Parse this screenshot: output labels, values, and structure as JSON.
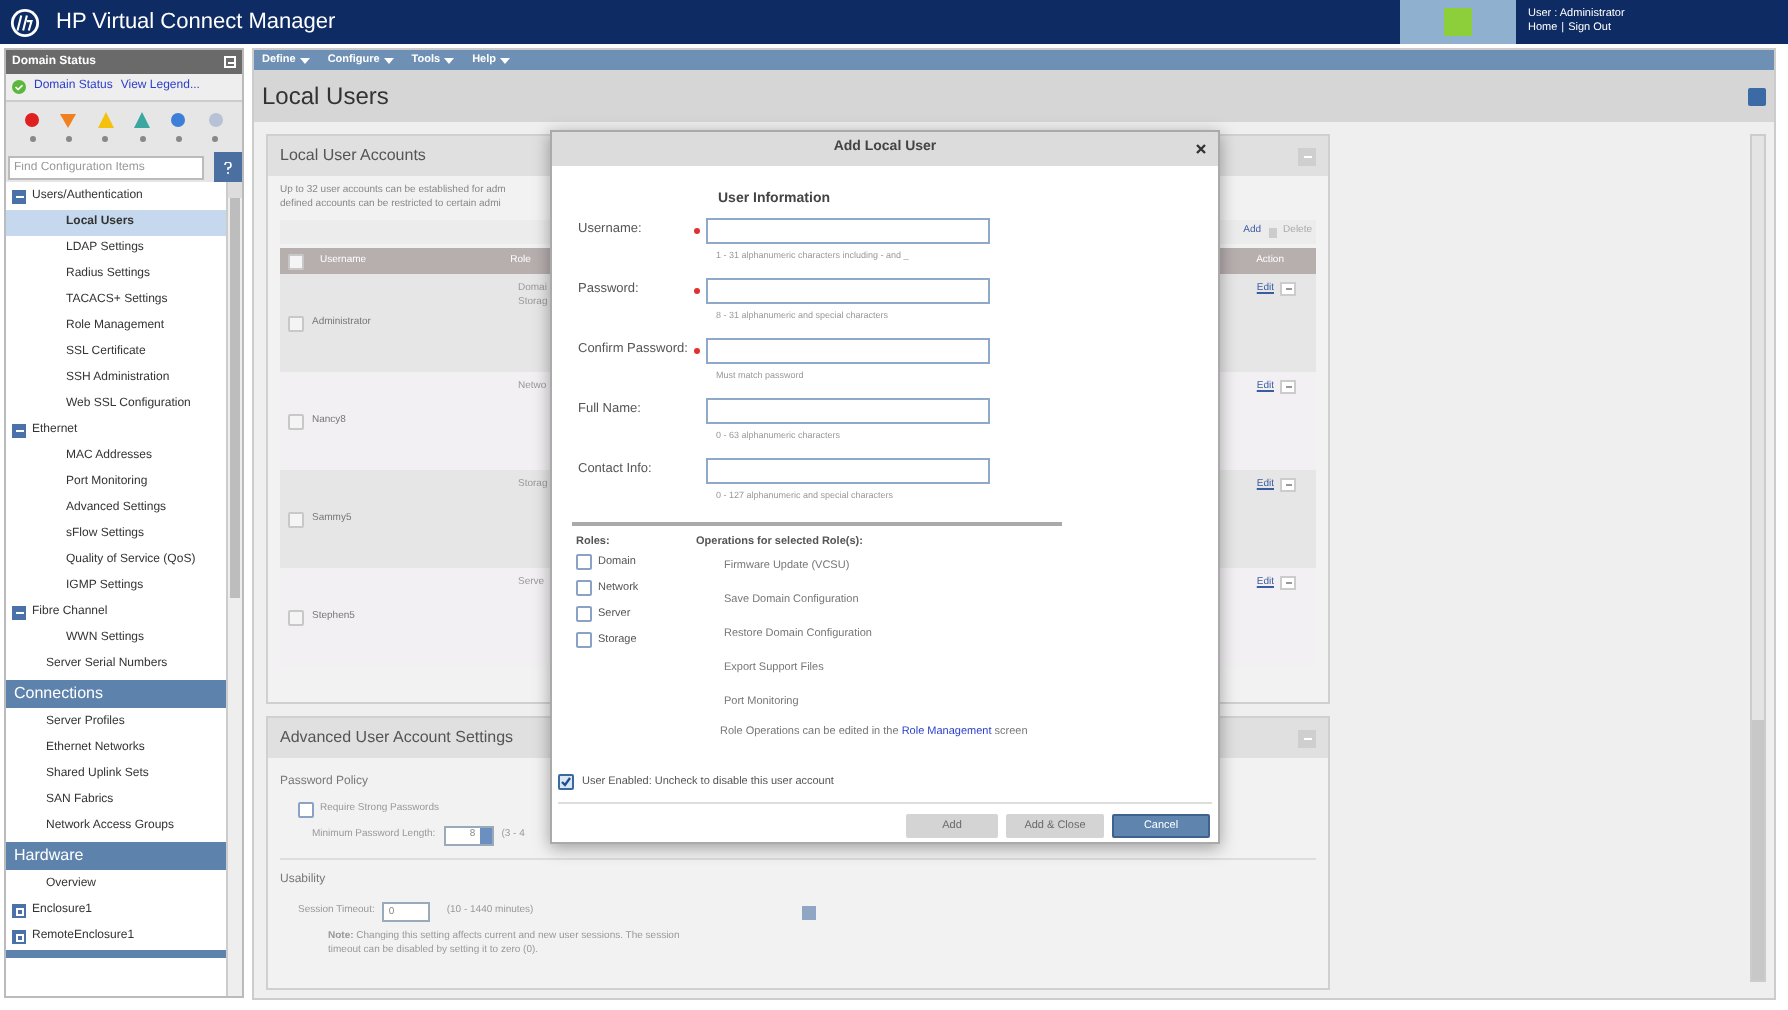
{
  "header": {
    "title": "HP Virtual Connect Manager",
    "user_label": "User : Administrator",
    "links": [
      "Home",
      "Sign Out"
    ],
    "link_separator": "|"
  },
  "sidebar": {
    "status_title": "Domain Status",
    "status_links": [
      "Domain Status",
      "View Legend..."
    ],
    "search": {
      "placeholder": "Find Configuration Items"
    },
    "tree": [
      {
        "kind": "group",
        "label": "Users/Authentication",
        "expanded": true,
        "children": [
          {
            "kind": "item",
            "label": "Local Users",
            "selected": true
          },
          {
            "kind": "item",
            "label": "LDAP Settings",
            "selected": false
          },
          {
            "kind": "item",
            "label": "Radius Settings",
            "selected": false
          },
          {
            "kind": "item",
            "label": "TACACS+ Settings",
            "selected": false
          },
          {
            "kind": "item",
            "label": "Role Management",
            "selected": false
          },
          {
            "kind": "item",
            "label": "SSL Certificate",
            "selected": false
          },
          {
            "kind": "item",
            "label": "SSH Administration",
            "selected": false
          },
          {
            "kind": "item",
            "label": "Web SSL Configuration",
            "selected": false
          }
        ]
      },
      {
        "kind": "group",
        "label": "Ethernet",
        "expanded": true,
        "children": [
          {
            "kind": "item",
            "label": "MAC Addresses",
            "selected": false
          },
          {
            "kind": "item",
            "label": "Port Monitoring",
            "selected": false
          },
          {
            "kind": "item",
            "label": "Advanced Settings",
            "selected": false
          },
          {
            "kind": "item",
            "label": "sFlow Settings",
            "selected": false
          },
          {
            "kind": "item",
            "label": "Quality of Service (QoS)",
            "selected": false
          },
          {
            "kind": "item",
            "label": "IGMP Settings",
            "selected": false
          }
        ]
      },
      {
        "kind": "group",
        "label": "Fibre Channel",
        "expanded": true,
        "children": [
          {
            "kind": "item",
            "label": "WWN Settings",
            "selected": false
          }
        ]
      },
      {
        "kind": "leaf",
        "label": "Server Serial Numbers",
        "selected": false
      },
      {
        "kind": "section",
        "label": "Connections"
      },
      {
        "kind": "leaf",
        "label": "Server Profiles",
        "selected": false
      },
      {
        "kind": "leaf",
        "label": "Ethernet Networks",
        "selected": false
      },
      {
        "kind": "leaf",
        "label": "Shared Uplink Sets",
        "selected": false
      },
      {
        "kind": "leaf",
        "label": "SAN Fabrics",
        "selected": false
      },
      {
        "kind": "leaf",
        "label": "Network Access Groups",
        "selected": false
      },
      {
        "kind": "section",
        "label": "Hardware"
      },
      {
        "kind": "leaf",
        "label": "Overview",
        "selected": false
      },
      {
        "kind": "group",
        "label": "Enclosure1",
        "expanded": false
      },
      {
        "kind": "group",
        "label": "RemoteEnclosure1",
        "expanded": false
      }
    ]
  },
  "menu": [
    {
      "label": "Define"
    },
    {
      "label": "Configure"
    },
    {
      "label": "Tools"
    },
    {
      "label": "Help"
    }
  ],
  "page_title": "Local Users",
  "accounts_panel": {
    "title": "Local User Accounts",
    "description_lines": [
      "Up to 32 user accounts can be established for adm",
      "defined accounts can be restricted to certain admi"
    ],
    "toolbar": [
      "Add",
      "Delete"
    ],
    "select_all_checked": false,
    "columns": [
      "Username",
      "Role",
      "Action"
    ],
    "rows": [
      {
        "username": "Administrator",
        "checked": false,
        "roles": [
          "Domai",
          "Storag"
        ],
        "action": "Edit"
      },
      {
        "username": "Nancy8",
        "checked": false,
        "roles": [
          "Netwo"
        ],
        "action": "Edit"
      },
      {
        "username": "Sammy5",
        "checked": false,
        "roles": [
          "Storag"
        ],
        "action": "Edit"
      },
      {
        "username": "Stephen5",
        "checked": false,
        "roles": [
          "Serve"
        ],
        "action": "Edit"
      }
    ]
  },
  "advanced_panel": {
    "title": "Advanced User Account Settings",
    "password_heading": "Password Policy",
    "require_strong": {
      "label": "Require Strong Passwords",
      "checked": false
    },
    "min_length": {
      "label": "Minimum Password Length:",
      "value": "8",
      "range": "(3 - 4"
    },
    "usability_heading": "Usability",
    "session_timeout": {
      "label": "Session Timeout:",
      "value": "0",
      "range": "(10 - 1440 minutes)"
    },
    "note_lines": [
      "**Note:** Changing this setting affects current and new user sessions. The session",
      "timeout can be disabled by setting it to zero (0)."
    ]
  },
  "dialog": {
    "title": "Add Local User",
    "section_title": "User Information",
    "fields": [
      {
        "label": "Username:",
        "required": true,
        "hint": "1 - 31 alphanumeric characters including - and _"
      },
      {
        "label": "Password:",
        "required": true,
        "hint": "8 - 31 alphanumeric and special characters"
      },
      {
        "label": "Confirm Password:",
        "required": true,
        "hint": "Must match password"
      },
      {
        "label": "Full Name:",
        "required": false,
        "hint": "0 - 63 alphanumeric characters"
      },
      {
        "label": "Contact Info:",
        "required": false,
        "hint": "0 - 127 alphanumeric and special characters"
      }
    ],
    "roles_heading": "Roles:",
    "roles": [
      {
        "label": "Domain",
        "checked": false
      },
      {
        "label": "Network",
        "checked": false
      },
      {
        "label": "Server",
        "checked": false
      },
      {
        "label": "Storage",
        "checked": false
      }
    ],
    "operations_heading": "Operations for selected Role(s):",
    "operations": [
      "Firmware Update (VCSU)",
      "Save Domain Configuration",
      "Restore Domain Configuration",
      "Export Support Files",
      "Port Monitoring"
    ],
    "role_note": {
      "before": "Role Operations can be edited in the",
      "link": "Role Management",
      "after": "screen"
    },
    "user_enabled": {
      "label": "User Enabled: Uncheck to disable this user account",
      "checked": true
    },
    "buttons": [
      {
        "label": "Add",
        "disabled": true
      },
      {
        "label": "Add & Close",
        "disabled": true
      },
      {
        "label": "Cancel",
        "disabled": false
      }
    ]
  }
}
